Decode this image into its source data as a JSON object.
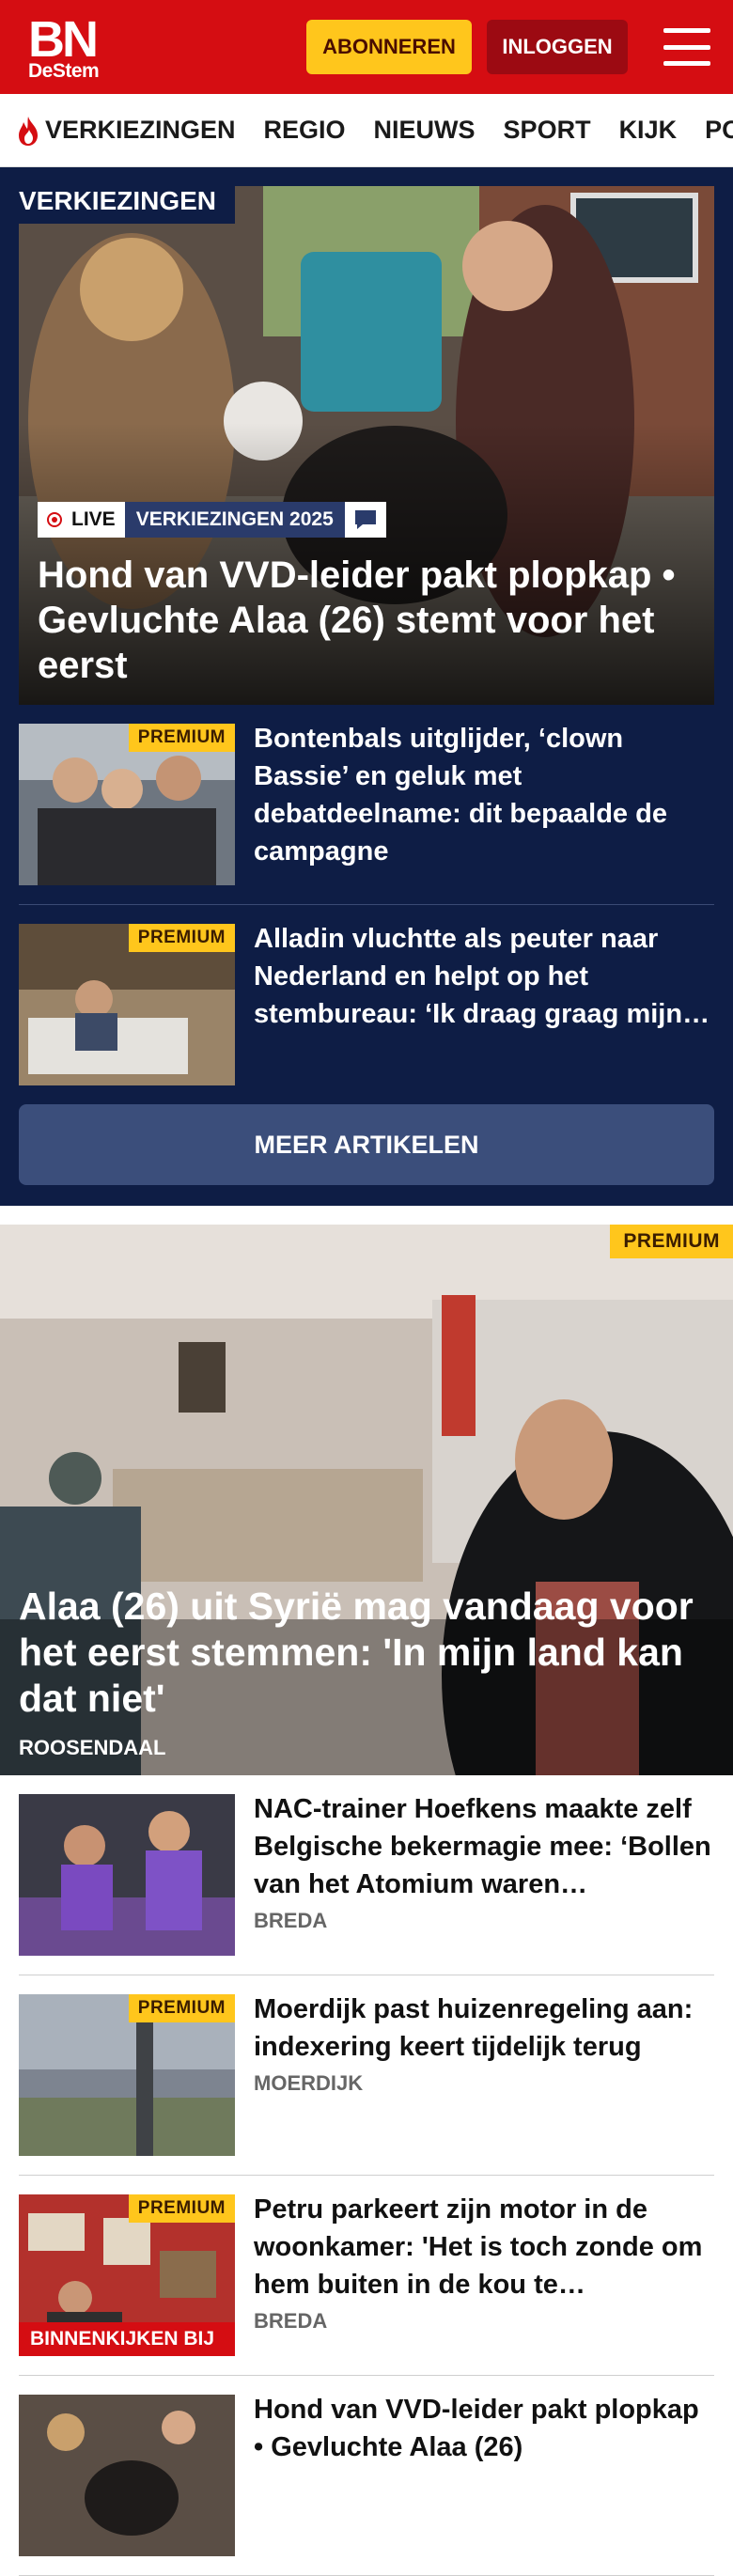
{
  "header": {
    "logo_bn": "BN",
    "logo_destem": "DeStem",
    "subscribe_label": "ABONNEREN",
    "login_label": "INLOGGEN",
    "brand_color": "#d50d12",
    "menu_icon": "hamburger-icon"
  },
  "nav": {
    "items": [
      "VERKIEZINGEN",
      "REGIO",
      "NIEUWS",
      "SPORT",
      "KIJK",
      "PODCAST"
    ],
    "first_icon": "flame-icon"
  },
  "elections": {
    "section_label": "VERKIEZINGEN",
    "hero": {
      "live_label": "LIVE",
      "tag_label": "VERKIEZINGEN 2025",
      "chat_icon": "chat-icon",
      "title": "Hond van VVD-leider pakt plopkap • Gevluchte Alaa (26) stemt voor het eerst"
    },
    "articles": [
      {
        "premium": "PREMIUM",
        "title": "Bontenbals uitglijder, ‘clown Bassie’ en geluk met debatdeelname: dit bepaalde de campagne"
      },
      {
        "premium": "PREMIUM",
        "title": "Alladin vluchtte als peuter naar Nederland en helpt op het stembureau: ‘Ik draag graag mijn…"
      }
    ],
    "more_label": "MEER ARTIKELEN"
  },
  "feature": {
    "premium": "PREMIUM",
    "title": "Alaa (26) uit Syrië mag vandaag voor het eerst stemmen: 'In mijn land kan dat niet'",
    "location": "ROOSENDAAL"
  },
  "list": [
    {
      "title": "NAC-trainer Hoefkens maakte zelf Belgische bekermagie mee: ‘Bollen van het Atomium waren…",
      "location": "BREDA",
      "premium": ""
    },
    {
      "title": "Moerdijk past huizenregeling aan: indexering keert tijdelijk terug",
      "location": "MOERDIJK",
      "premium": "PREMIUM"
    },
    {
      "title": "Petru parkeert zijn motor in de woonkamer: 'Het is toch zonde om hem buiten in de kou te…",
      "location": "BREDA",
      "premium": "PREMIUM",
      "tag": "BINNENKIJKEN BIJ"
    },
    {
      "title": "Hond van VVD-leider pakt plopkap • Gevluchte Alaa (26)",
      "location": "",
      "premium": ""
    }
  ]
}
